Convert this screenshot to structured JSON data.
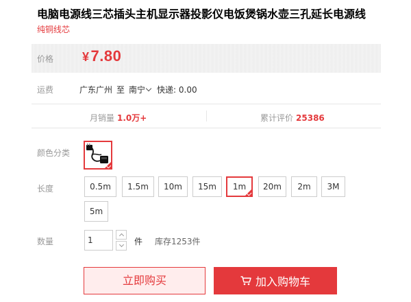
{
  "product": {
    "title": "电脑电源线三芯插头主机显示器投影仪电饭煲锅水壶三孔延长电源线",
    "subtitle": "纯铜线芯"
  },
  "price": {
    "label": "价格",
    "currency": "¥",
    "value": "7.80"
  },
  "shipping": {
    "label": "运费",
    "from": "广东广州",
    "to_prefix": "至",
    "to": "南宁",
    "delivery": "快递: 0.00"
  },
  "stats": {
    "monthly_sales_label": "月销量",
    "monthly_sales_value": "1.0万+",
    "reviews_label": "累计评价",
    "reviews_value": "25386"
  },
  "color": {
    "label": "颜色分类"
  },
  "length": {
    "label": "长度",
    "options": [
      "0.5m",
      "1.5m",
      "10m",
      "15m",
      "1m",
      "20m",
      "2m",
      "3M",
      "5m"
    ],
    "selected": "1m"
  },
  "quantity": {
    "label": "数量",
    "value": "1",
    "unit": "件",
    "stock": "库存1253件"
  },
  "actions": {
    "buy_now": "立即购买",
    "add_to_cart": "加入购物车"
  },
  "colors": {
    "accent": "#e4393c",
    "buy_bg": "#ffeded",
    "muted": "#999999"
  },
  "icons": {
    "cart": "shopping-cart-icon",
    "selected_mark": "check-corner-icon"
  }
}
